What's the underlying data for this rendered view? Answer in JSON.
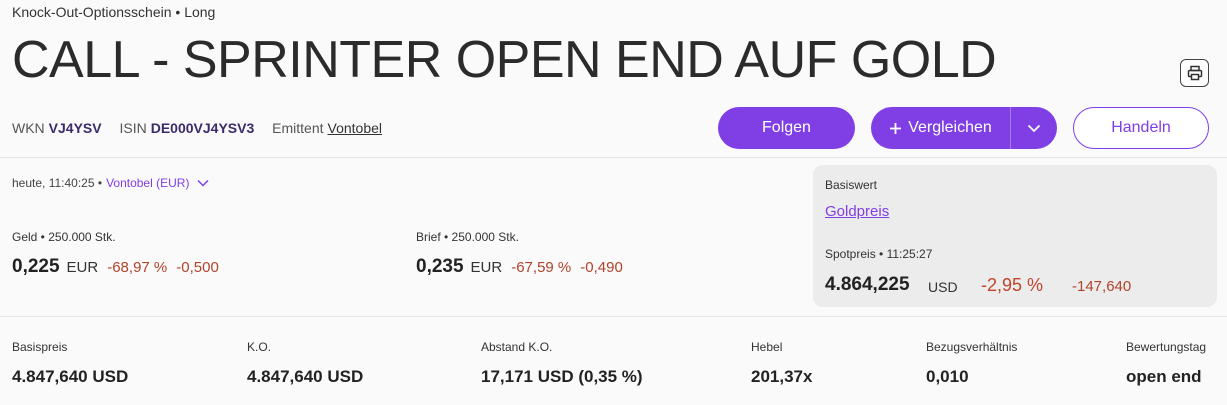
{
  "header": {
    "category": "Knock-Out-Optionsschein • Long",
    "title": "CALL - SPRINTER OPEN END AUF GOLD"
  },
  "identifiers": {
    "wkn_label": "WKN",
    "wkn": "VJ4YSV",
    "isin_label": "ISIN",
    "isin": "DE000VJ4YSV3",
    "issuer_label": "Emittent",
    "issuer": "Vontobel"
  },
  "actions": {
    "follow": "Folgen",
    "compare": "Vergleichen",
    "trade": "Handeln"
  },
  "quote": {
    "timestamp": "heute, 11:40:25 •",
    "venue": "Vontobel (EUR)",
    "bid": {
      "label": "Geld • 250.000 Stk.",
      "price": "0,225",
      "currency": "EUR",
      "change_pct": "-68,97 %",
      "change_abs": "-0,500"
    },
    "ask": {
      "label": "Brief • 250.000 Stk.",
      "price": "0,235",
      "currency": "EUR",
      "change_pct": "-67,59 %",
      "change_abs": "-0,490"
    }
  },
  "underlying": {
    "label": "Basiswert",
    "name": "Goldpreis",
    "spot_label": "Spotpreis • 11:25:27",
    "price": "4.864,225",
    "currency": "USD",
    "change_pct": "-2,95 %",
    "change_abs": "-147,640"
  },
  "key_figures": [
    {
      "label": "Basispreis",
      "value": "4.847,640 USD"
    },
    {
      "label": "K.O.",
      "value": "4.847,640 USD"
    },
    {
      "label": "Abstand K.O.",
      "value": "17,171 USD (0,35 %)"
    },
    {
      "label": "Hebel",
      "value": "201,37x"
    },
    {
      "label": "Bezugsverhältnis",
      "value": "0,010"
    },
    {
      "label": "Bewertungstag",
      "value": "open end"
    }
  ],
  "colors": {
    "accent": "#7f3fe4",
    "negative": "#b0432b"
  },
  "icons": {
    "print": "printer-icon",
    "venue_dropdown": "chevron-down-icon",
    "compare_plus": "plus-icon",
    "compare_dropdown": "chevron-down-icon"
  }
}
